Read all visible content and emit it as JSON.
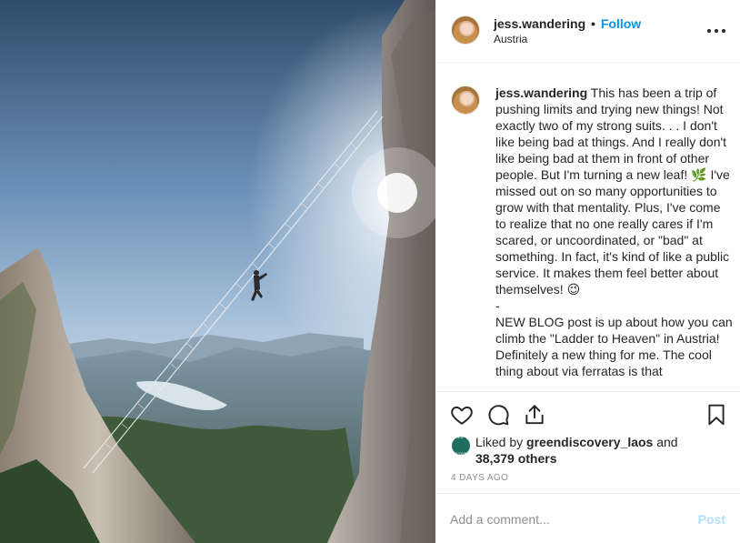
{
  "post": {
    "image_icon": "photo-ladder-to-heaven"
  },
  "header": {
    "username": "jess.wandering",
    "separator": "•",
    "follow_label": "Follow",
    "location": "Austria",
    "more_icon": "ellipsis-icon"
  },
  "caption": {
    "username": "jess.wandering",
    "lines": [
      "This has been a trip of pushing limits and trying new things! Not exactly two of my strong suits. . . I don't like being bad at things. And I really don't like being bad at them in front of other people. But I'm turning a new leaf! 🌿 I've missed out on so many opportunities to grow with that mentality. Plus, I've come to realize that no one really cares if I'm scared, or uncoordinated, or \"bad\" at something. In fact, it's kind of like a public service. It makes them feel better about themselves! 😉",
      "-",
      "NEW BLOG post is up about how you can climb the \"Ladder to Heaven\" in Austria! Definitely a new thing for me. The cool thing about via ferratas is that"
    ]
  },
  "actions": {
    "like_icon": "heart-icon",
    "comment_icon": "comment-bubble-icon",
    "share_icon": "share-icon",
    "save_icon": "bookmark-icon"
  },
  "likes": {
    "prefix": "Liked by ",
    "user": "greendiscovery_laos",
    "middle": " and",
    "count": "38,379 others",
    "avatar_text": "GREEN DISCOVERY"
  },
  "timestamp": "4 DAYS AGO",
  "comment_box": {
    "placeholder": "Add a comment...",
    "post_label": "Post"
  },
  "colors": {
    "accent": "#0095f6",
    "post_disabled": "#b2dffc",
    "text": "#262626",
    "muted": "#8e8e8e"
  }
}
